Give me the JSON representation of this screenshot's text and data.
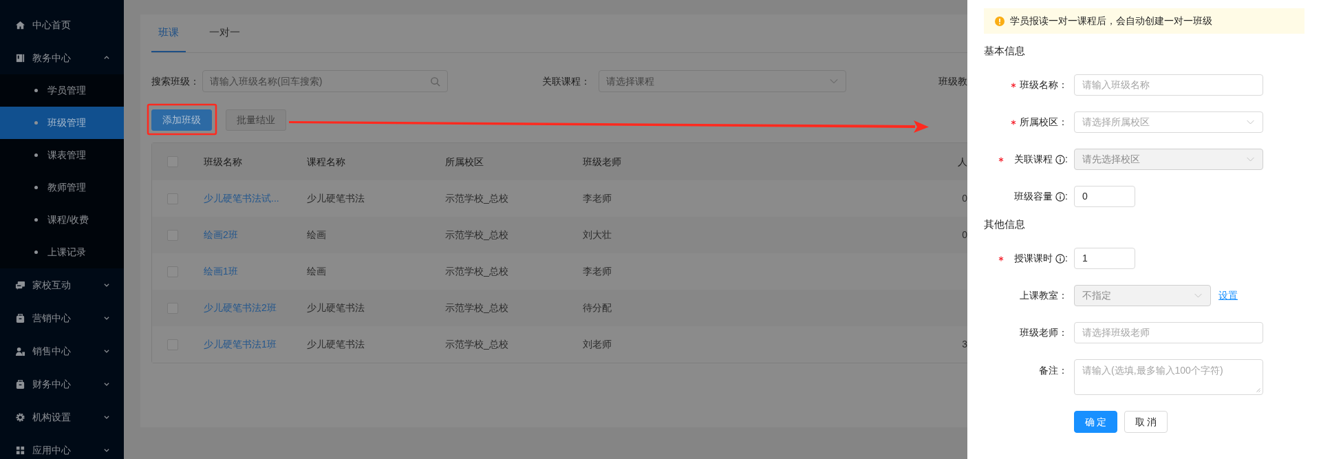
{
  "sidebar": {
    "items": [
      {
        "label": "中心首页",
        "kind": "link"
      },
      {
        "label": "教务中心",
        "kind": "group",
        "expanded": true,
        "children": [
          {
            "label": "学员管理",
            "selected": false
          },
          {
            "label": "班级管理",
            "selected": true
          },
          {
            "label": "课表管理",
            "selected": false
          },
          {
            "label": "教师管理",
            "selected": false
          },
          {
            "label": "课程/收费",
            "selected": false
          },
          {
            "label": "上课记录",
            "selected": false
          }
        ]
      },
      {
        "label": "家校互动",
        "kind": "group",
        "expanded": false
      },
      {
        "label": "营销中心",
        "kind": "group",
        "expanded": false
      },
      {
        "label": "销售中心",
        "kind": "group",
        "expanded": false
      },
      {
        "label": "财务中心",
        "kind": "group",
        "expanded": false
      },
      {
        "label": "机构设置",
        "kind": "group",
        "expanded": false
      },
      {
        "label": "应用中心",
        "kind": "group",
        "expanded": false
      }
    ]
  },
  "tabs": [
    {
      "label": "班课",
      "selected": true
    },
    {
      "label": "一对一",
      "selected": false
    }
  ],
  "filters": [
    {
      "kind": "search",
      "label": "搜索班级：",
      "placeholder": "请输入班级名称(回车搜索)"
    },
    {
      "kind": "select",
      "label": "关联课程：",
      "placeholder": "请选择课程"
    },
    {
      "kind": "label",
      "label": "班级教"
    }
  ],
  "actions": [
    {
      "label": "添加班级",
      "kind": "primary",
      "disabled": false
    },
    {
      "label": "批量结业",
      "kind": "default",
      "disabled": true
    }
  ],
  "table": {
    "header_checked": false,
    "columns": [
      "班级名称",
      "课程名称",
      "所属校区",
      "班级老师",
      "人"
    ],
    "rows": [
      {
        "checked": false,
        "cells": [
          "少儿硬笔书法试...",
          "少儿硬笔书法",
          "示范学校_总校",
          "李老师",
          "0"
        ]
      },
      {
        "checked": false,
        "cells": [
          "绘画2班",
          "绘画",
          "示范学校_总校",
          "刘大壮",
          "0"
        ]
      },
      {
        "checked": false,
        "cells": [
          "绘画1班",
          "绘画",
          "示范学校_总校",
          "李老师"
        ]
      },
      {
        "checked": false,
        "cells": [
          "少儿硬笔书法2班",
          "少儿硬笔书法",
          "示范学校_总校",
          "待分配"
        ]
      },
      {
        "checked": false,
        "cells": [
          "少儿硬笔书法1班",
          "少儿硬笔书法",
          "示范学校_总校",
          "刘老师",
          "3"
        ]
      }
    ]
  },
  "annotations": {
    "highlight_box": true,
    "arrow": true
  },
  "drawer": {
    "alert": {
      "kind": "warning",
      "text": "学员报读一对一课程后，会自动创建一对一班级"
    },
    "sections": [
      {
        "title": "基本信息",
        "fields": [
          {
            "label": "班级名称",
            "colon": "：",
            "required": true,
            "info": false,
            "kind": "input",
            "placeholder": "请输入班级名称"
          },
          {
            "label": "所属校区",
            "colon": "：",
            "required": true,
            "info": false,
            "kind": "select",
            "placeholder": "请选择所属校区",
            "disabled": false
          },
          {
            "label": "关联课程",
            "colon": ":",
            "required": true,
            "info": true,
            "kind": "select",
            "placeholder": "请先选择校区",
            "disabled": true
          },
          {
            "label": "班级容量",
            "colon": ":",
            "required": false,
            "info": true,
            "kind": "short",
            "value": "0"
          }
        ]
      },
      {
        "title": "其他信息",
        "fields": [
          {
            "label": "授课课时",
            "colon": ":",
            "required": true,
            "info": true,
            "kind": "short",
            "value": "1"
          },
          {
            "label": "上课教室",
            "colon": "：",
            "required": false,
            "info": false,
            "kind": "select",
            "placeholder": "不指定",
            "disabled": true,
            "link": "设置"
          },
          {
            "label": "班级老师",
            "colon": "：",
            "required": false,
            "info": false,
            "kind": "input",
            "placeholder": "请选择班级老师"
          },
          {
            "label": "备注",
            "colon": "：",
            "required": false,
            "info": false,
            "kind": "textarea",
            "placeholder": "请输入(选填,最多输入100个字符)"
          }
        ]
      }
    ],
    "buttons": [
      {
        "label": "确 定",
        "kind": "primary"
      },
      {
        "label": "取 消",
        "kind": "default"
      }
    ]
  }
}
